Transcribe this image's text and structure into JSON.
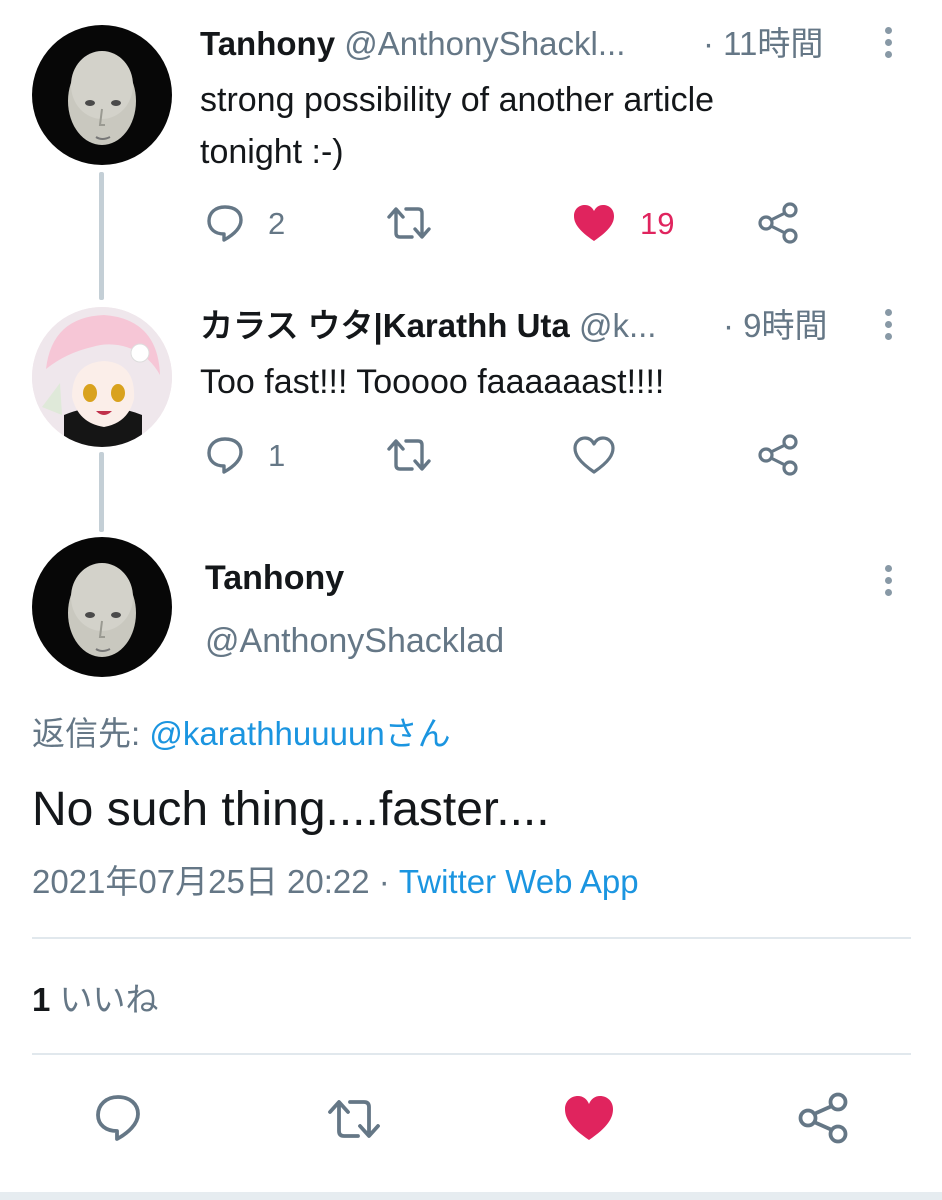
{
  "tweets": [
    {
      "name": "Tanhony",
      "handle": "@AnthonyShackl...",
      "time": "· 11時間",
      "text_lines": [
        "strong possibility of another article",
        "tonight :-)"
      ],
      "replies": "2",
      "likes": "19",
      "liked": true
    },
    {
      "name": "カラス ウタ|Karathh Uta",
      "handle": "@k...",
      "time": "· 9時間",
      "text_lines": [
        "Too fast!!! Tooooo faaaaaast!!!!"
      ],
      "replies": "1",
      "likes": "",
      "liked": false
    }
  ],
  "main_tweet": {
    "name": "Tanhony",
    "handle": "@AnthonyShacklad",
    "reply_to_prefix": "返信先:",
    "reply_to_user": "@karathhuuuunさん",
    "text": "No such thing....faster....",
    "timestamp": "2021年07月25日 20:22",
    "separator": "·",
    "source": "Twitter Web App",
    "like_count": "1",
    "like_label": "いいね",
    "liked": true
  },
  "colors": {
    "like_active": "#e0245e",
    "link": "#1b95e0",
    "icon_gray": "#657786",
    "thread_line": "#c4cfd6"
  },
  "icons": [
    "reply-icon",
    "retweet-icon",
    "like-icon",
    "share-icon",
    "more-icon"
  ]
}
